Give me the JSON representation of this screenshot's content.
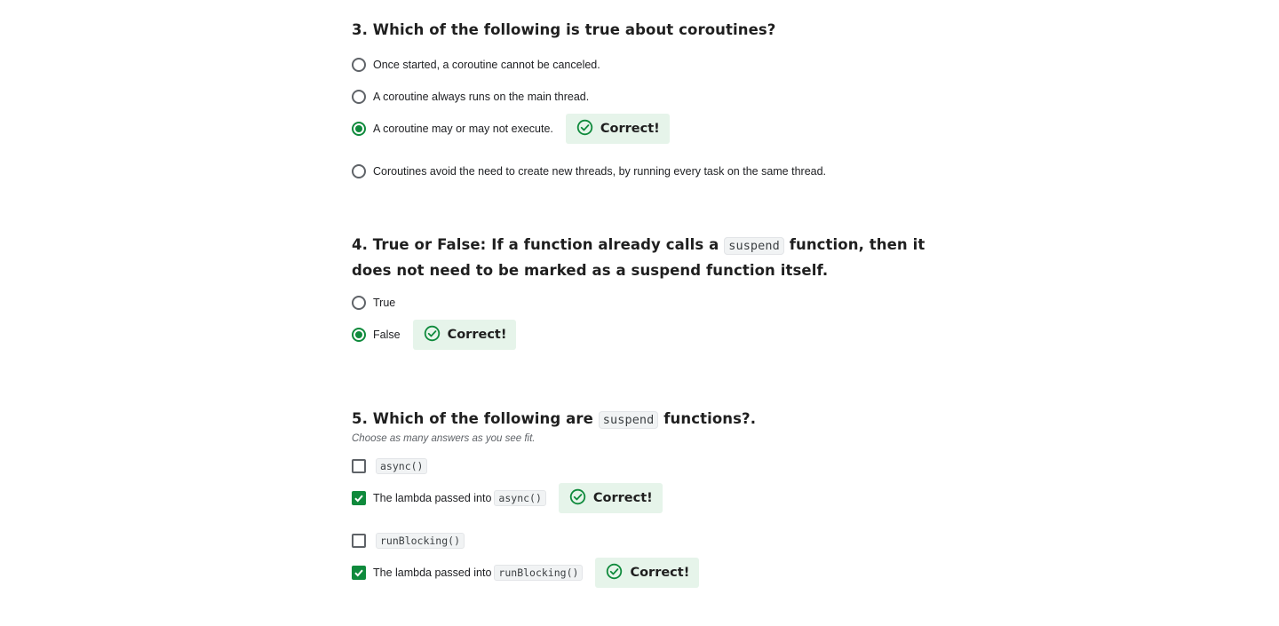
{
  "correct_label": "Correct!",
  "q3": {
    "title": "3. Which of the following is true about coroutines?",
    "options": [
      "Once started, a coroutine cannot be canceled.",
      "A coroutine always runs on the main thread.",
      "A coroutine may or may not execute.",
      "Coroutines avoid the need to create new threads, by running every task on the same thread."
    ],
    "selected_index": 2
  },
  "q4": {
    "title_before": "4. True or False: If a function already calls a",
    "title_code": "suspend",
    "title_after": "function, then it does not need to be marked as a suspend function itself.",
    "options": [
      "True",
      "False"
    ],
    "selected_index": 1
  },
  "q5": {
    "title_before": "5. Which of the following are",
    "title_code": "suspend",
    "title_after": "functions?.",
    "subtitle": "Choose as many answers as you see fit.",
    "options": [
      {
        "text": "",
        "code": "async()",
        "checked": false
      },
      {
        "text": "The lambda passed into",
        "code": "async()",
        "checked": true
      },
      {
        "text": "",
        "code": "runBlocking()",
        "checked": false
      },
      {
        "text": "The lambda passed into",
        "code": "runBlocking()",
        "checked": true
      }
    ]
  },
  "colors": {
    "accent": "#0f8a3c",
    "correct_bg": "#e6f4ea"
  },
  "icons": {
    "correct": "check-circle-icon"
  }
}
